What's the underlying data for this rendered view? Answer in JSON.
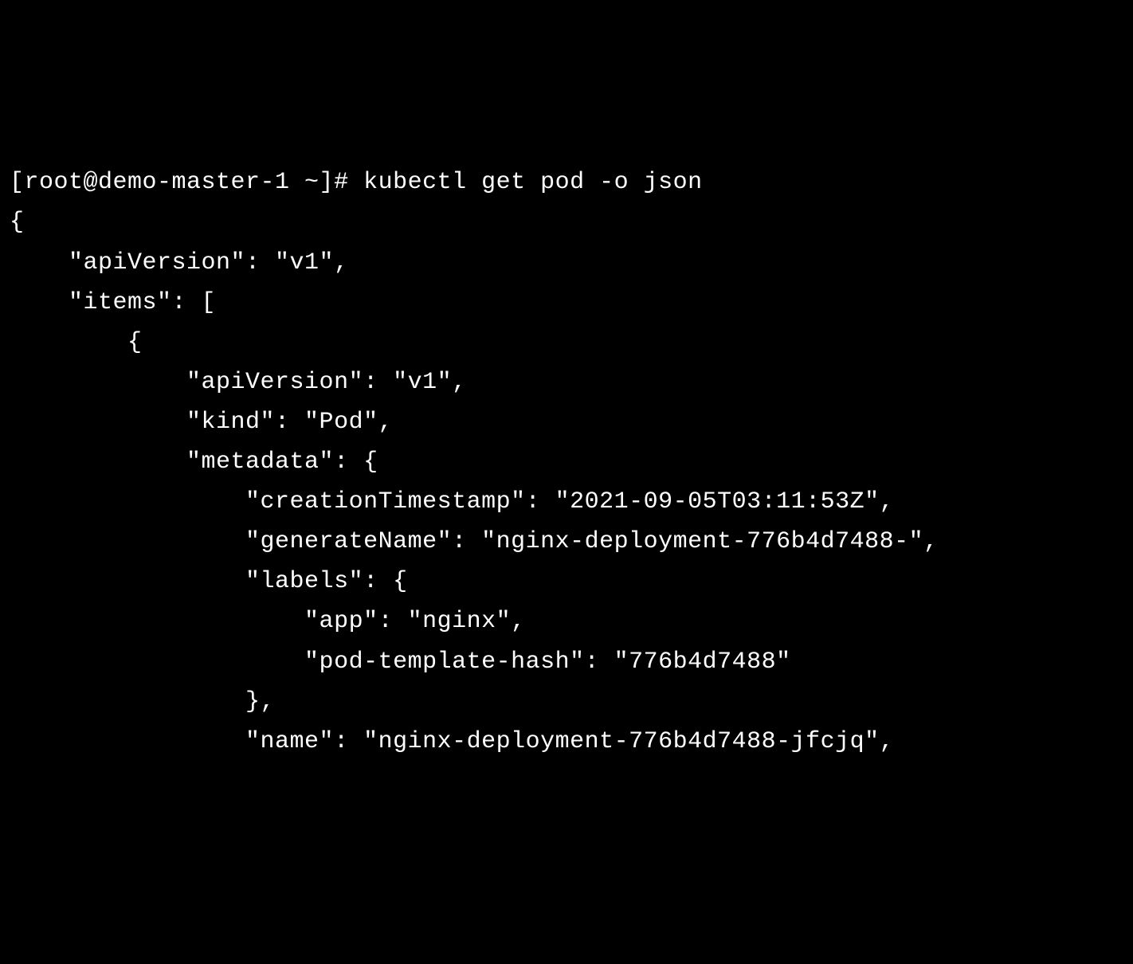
{
  "terminal": {
    "prompt": "[root@demo-master-1 ~]# ",
    "command": "kubectl get pod -o json",
    "lines": [
      "{",
      "    \"apiVersion\": \"v1\",",
      "    \"items\": [",
      "        {",
      "            \"apiVersion\": \"v1\",",
      "            \"kind\": \"Pod\",",
      "            \"metadata\": {",
      "                \"creationTimestamp\": \"2021-09-05T03:11:53Z\",",
      "                \"generateName\": \"nginx-deployment-776b4d7488-\",",
      "                \"labels\": {",
      "                    \"app\": \"nginx\",",
      "                    \"pod-template-hash\": \"776b4d7488\"",
      "                },",
      "                \"name\": \"nginx-deployment-776b4d7488-jfcjq\","
    ]
  }
}
